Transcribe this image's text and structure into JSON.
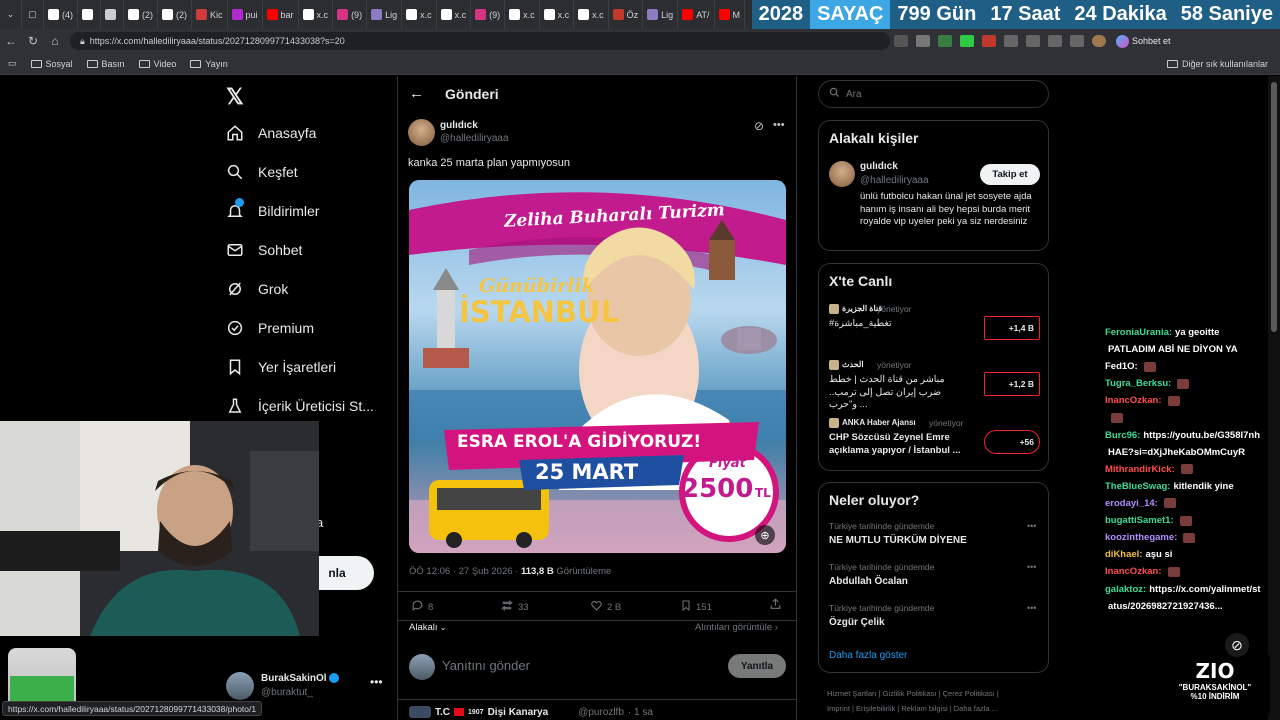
{
  "browser": {
    "tabs": [
      {
        "label": "(4)",
        "color": "#ffffff"
      },
      {
        "label": "",
        "color": "#ffffff"
      },
      {
        "label": "",
        "color": "#cccccc"
      },
      {
        "label": "(2)",
        "color": "#ffffff"
      },
      {
        "label": "(2)",
        "color": "#ffffff"
      },
      {
        "label": "Kic",
        "color": "#d13a3a"
      },
      {
        "label": "pui",
        "color": "#b12ad0"
      },
      {
        "label": "bar",
        "color": "#ff0000"
      },
      {
        "label": "x.c",
        "color": "#ffffff"
      },
      {
        "label": "(9)",
        "color": "#d63384"
      },
      {
        "label": "Lig",
        "color": "#8e7cc3"
      },
      {
        "label": "x.c",
        "color": "#ffffff"
      },
      {
        "label": "x.c",
        "color": "#ffffff"
      },
      {
        "label": "(9)",
        "color": "#d63384"
      },
      {
        "label": "x.c",
        "color": "#ffffff"
      },
      {
        "label": "x.c",
        "color": "#ffffff"
      },
      {
        "label": "x.c",
        "color": "#ffffff"
      },
      {
        "label": "Öz",
        "color": "#c0392b"
      },
      {
        "label": "Lig",
        "color": "#8e7cc3"
      },
      {
        "label": "AT/",
        "color": "#ff0000"
      },
      {
        "label": "M",
        "color": "#ff0000"
      }
    ],
    "counter": {
      "year": "2028",
      "label": "SAYAÇ",
      "days": "799 Gün",
      "hours": "17 Saat",
      "minutes": "24 Dakika",
      "seconds": "58 Saniye"
    },
    "url": "https://x.com/hallediliryaaa/status/2027128099771433038?s=20",
    "chat_button": "Sohbet et",
    "bookmarks": [
      "Sosyal",
      "Basın",
      "Video",
      "Yayın"
    ],
    "other_bookmarks": "Diğer sık kullanılanlar",
    "status_url": "https://x.com/hallediliryaaa/status/2027128099771433038/photo/1"
  },
  "nav": {
    "items": [
      "Anasayfa",
      "Keşfet",
      "Bildirimler",
      "Sohbet",
      "Grok",
      "Premium",
      "Yer İşaretleri",
      "İçerik Üreticisi St..."
    ],
    "post_button_partial": "nla",
    "partial_item": "a",
    "account": {
      "name": "BurakSakinOl",
      "handle": "@buraktut_"
    }
  },
  "post": {
    "header": "Gönderi",
    "author_name": "gulıdıck",
    "author_handle": "@hallediliryaaa",
    "text": "kanka 25 marta plan yapmıyosun",
    "timestamp": "ÖÖ 12:06 · 27 Şub 2026 ·",
    "views": "113,8 B",
    "views_label": "Görüntüleme",
    "image": {
      "banner": "Zeliha Buharalı Turizm",
      "line1": "Günübirlik",
      "line2": "İSTANBUL",
      "line3": "ESRA EROL'A GİDİYORUZ!",
      "date": "25 MART",
      "price_label": "Fiyat",
      "price": "2500",
      "currency": "TL"
    },
    "stats": {
      "replies": "8",
      "reposts": "33",
      "likes": "2 B",
      "bookmarks": "151"
    },
    "sort_label": "Alakalı",
    "quotes_label": "Alıntıları görüntüle",
    "reply_placeholder": "Yanıtını gönder",
    "reply_button": "Yanıtla",
    "next_tweet": {
      "name": "T.C",
      "badge": "1907",
      "name2": "Dişi Kanarya",
      "handle": "@purozlfb",
      "time": "· 1 sa"
    }
  },
  "sidebar": {
    "search_placeholder": "Ara",
    "related": {
      "title": "Alakalı kişiler",
      "name": "gulıdıck",
      "handle": "@hallediliryaaa",
      "follow": "Takip et",
      "bio": "ünlü futbolcu hakan ünal jet sosyete ajda hanım iş insanı ali bey hepsi burda merit royalde vip uyeler peki ya siz nerdesiniz"
    },
    "live": {
      "title": "X'te Canlı",
      "items": [
        {
          "source": "قناة الجزيرة",
          "status": "yönetiyor",
          "title": "#تغطية_مباشرة",
          "count": "+1,4 B"
        },
        {
          "source": "الحدث",
          "status": "yönetiyor",
          "title": "مباشر من قناة الحدث | خطط ضرب إيران تصل إلى ترمب.. و\"حرب ...",
          "count": "+1,2 B"
        },
        {
          "source": "ANKA Haber Ajansı",
          "status": "yönetiyor",
          "title": "CHP Sözcüsü Zeynel Emre açıklama yapıyor / İstanbul ...",
          "count": "+56"
        }
      ]
    },
    "trends": {
      "title": "Neler oluyor?",
      "items": [
        {
          "context": "Türkiye tarihinde gündemde",
          "title": "NE MUTLU TÜRKÜM DİYENE"
        },
        {
          "context": "Türkiye tarihinde gündemde",
          "title": "Abdullah Öcalan"
        },
        {
          "context": "Türkiye tarihinde gündemde",
          "title": "Özgür Çelik"
        }
      ],
      "more": "Daha fazla göster"
    },
    "footer": [
      "Hizmet Şartları",
      "Gizlilik Politikası",
      "Çerez Politikası",
      "Imprint",
      "Erişilebilirlik",
      "Reklam bilgisi",
      "Daha fazla ..."
    ]
  },
  "chat": [
    {
      "user": "FeroniaUrania:",
      "color": "#3ddc97",
      "msg": "ya geoitte"
    },
    {
      "user": "",
      "color": "#ffffff",
      "msg": "PATLADIM ABİ NE DİYON YA"
    },
    {
      "user": "Fed1O:",
      "color": "#ffffff",
      "msg": ""
    },
    {
      "user": "Tugra_Berksu:",
      "color": "#3ddc97",
      "msg": ""
    },
    {
      "user": "InancOzkan:",
      "color": "#ff4d4d",
      "msg": ""
    },
    {
      "user": "",
      "color": "#ff4d4d",
      "msg": ""
    },
    {
      "user": "Burc96:",
      "color": "#3ddc97",
      "msg": "https://youtu.be/G358I7nh"
    },
    {
      "user": "",
      "color": "#ffffff",
      "msg": "HAE?si=dXjJheKabOMmCuyR"
    },
    {
      "user": "MithrandirKick:",
      "color": "#ff4d4d",
      "msg": ""
    },
    {
      "user": "TheBlueSwag:",
      "color": "#3ddc97",
      "msg": "kitlendik yine"
    },
    {
      "user": "erodayi_14:",
      "color": "#b48cff",
      "msg": ""
    },
    {
      "user": "bugattiSamet1:",
      "color": "#3ddc97",
      "msg": ""
    },
    {
      "user": "koozinthegame:",
      "color": "#b48cff",
      "msg": ""
    },
    {
      "user": "diKhael:",
      "color": "#f0c040",
      "msg": "aşu si"
    },
    {
      "user": "InancOzkan:",
      "color": "#ff4d4d",
      "msg": ""
    },
    {
      "user": "galaktoz:",
      "color": "#3ddc97",
      "msg": "https://x.com/yalinmet/st"
    },
    {
      "user": "",
      "color": "#ffffff",
      "msg": "atus/2026982721927436..."
    }
  ],
  "promo": {
    "logo": "ZIO",
    "line1": "\"BURAKSAKİNOL\"",
    "line2": "%10 İNDİRİM"
  }
}
